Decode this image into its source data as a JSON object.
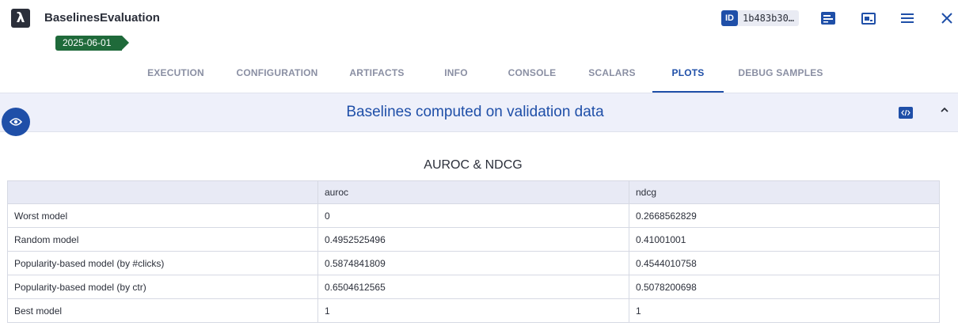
{
  "app": {
    "logo_glyph": "λ",
    "title": "BaselinesEvaluation",
    "tag": "2025-06-01",
    "id_label": "ID",
    "id_value": "1b483b30…"
  },
  "tabs": [
    {
      "label": "EXECUTION",
      "active": false
    },
    {
      "label": "CONFIGURATION",
      "active": false
    },
    {
      "label": "ARTIFACTS",
      "active": false
    },
    {
      "label": "INFO",
      "active": false
    },
    {
      "label": "CONSOLE",
      "active": false
    },
    {
      "label": "SCALARS",
      "active": false
    },
    {
      "label": "PLOTS",
      "active": true
    },
    {
      "label": "DEBUG SAMPLES",
      "active": false
    }
  ],
  "panel": {
    "title": "Baselines computed on validation data"
  },
  "chart_data": {
    "type": "table",
    "title": "AUROC & NDCG",
    "columns": [
      "",
      "auroc",
      "ndcg"
    ],
    "rows": [
      [
        "Worst model",
        "0",
        "0.2668562829"
      ],
      [
        "Random model",
        "0.4952525496",
        "0.41001001"
      ],
      [
        "Popularity-based model (by #clicks)",
        "0.5874841809",
        "0.4544010758"
      ],
      [
        "Popularity-based model (by ctr)",
        "0.6504612565",
        "0.5078200698"
      ],
      [
        "Best model",
        "1",
        "1"
      ]
    ]
  },
  "colors": {
    "accent": "#1f4fa8",
    "tag": "#1f6a3a",
    "panel_bg": "#eef0fa"
  }
}
